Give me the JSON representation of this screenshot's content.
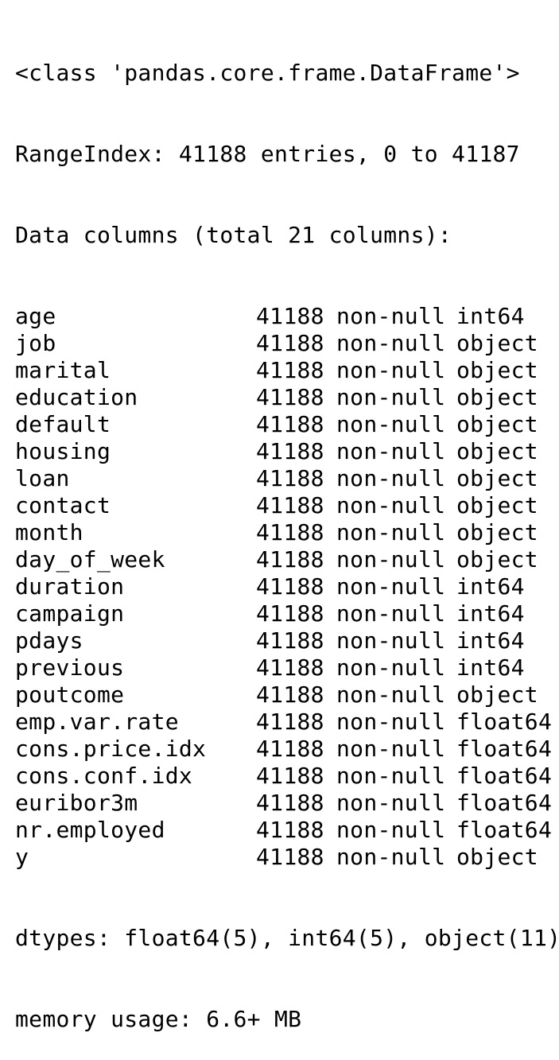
{
  "header": {
    "class_line": "<class 'pandas.core.frame.DataFrame'>",
    "index_line": "RangeIndex: 41188 entries, 0 to 41187",
    "columns_line": "Data columns (total 21 columns):"
  },
  "columns": [
    {
      "name": "age",
      "count": "41188",
      "null": "non-null",
      "dtype": "int64"
    },
    {
      "name": "job",
      "count": "41188",
      "null": "non-null",
      "dtype": "object"
    },
    {
      "name": "marital",
      "count": "41188",
      "null": "non-null",
      "dtype": "object"
    },
    {
      "name": "education",
      "count": "41188",
      "null": "non-null",
      "dtype": "object"
    },
    {
      "name": "default",
      "count": "41188",
      "null": "non-null",
      "dtype": "object"
    },
    {
      "name": "housing",
      "count": "41188",
      "null": "non-null",
      "dtype": "object"
    },
    {
      "name": "loan",
      "count": "41188",
      "null": "non-null",
      "dtype": "object"
    },
    {
      "name": "contact",
      "count": "41188",
      "null": "non-null",
      "dtype": "object"
    },
    {
      "name": "month",
      "count": "41188",
      "null": "non-null",
      "dtype": "object"
    },
    {
      "name": "day_of_week",
      "count": "41188",
      "null": "non-null",
      "dtype": "object"
    },
    {
      "name": "duration",
      "count": "41188",
      "null": "non-null",
      "dtype": "int64"
    },
    {
      "name": "campaign",
      "count": "41188",
      "null": "non-null",
      "dtype": "int64"
    },
    {
      "name": "pdays",
      "count": "41188",
      "null": "non-null",
      "dtype": "int64"
    },
    {
      "name": "previous",
      "count": "41188",
      "null": "non-null",
      "dtype": "int64"
    },
    {
      "name": "poutcome",
      "count": "41188",
      "null": "non-null",
      "dtype": "object"
    },
    {
      "name": "emp.var.rate",
      "count": "41188",
      "null": "non-null",
      "dtype": "float64"
    },
    {
      "name": "cons.price.idx",
      "count": "41188",
      "null": "non-null",
      "dtype": "float64"
    },
    {
      "name": "cons.conf.idx",
      "count": "41188",
      "null": "non-null",
      "dtype": "float64"
    },
    {
      "name": "euribor3m",
      "count": "41188",
      "null": "non-null",
      "dtype": "float64"
    },
    {
      "name": "nr.employed",
      "count": "41188",
      "null": "non-null",
      "dtype": "float64"
    },
    {
      "name": "y",
      "count": "41188",
      "null": "non-null",
      "dtype": "object"
    }
  ],
  "footer": {
    "dtypes_line": "dtypes: float64(5), int64(5), object(11)",
    "memory_line": "memory usage: 6.6+ MB"
  }
}
